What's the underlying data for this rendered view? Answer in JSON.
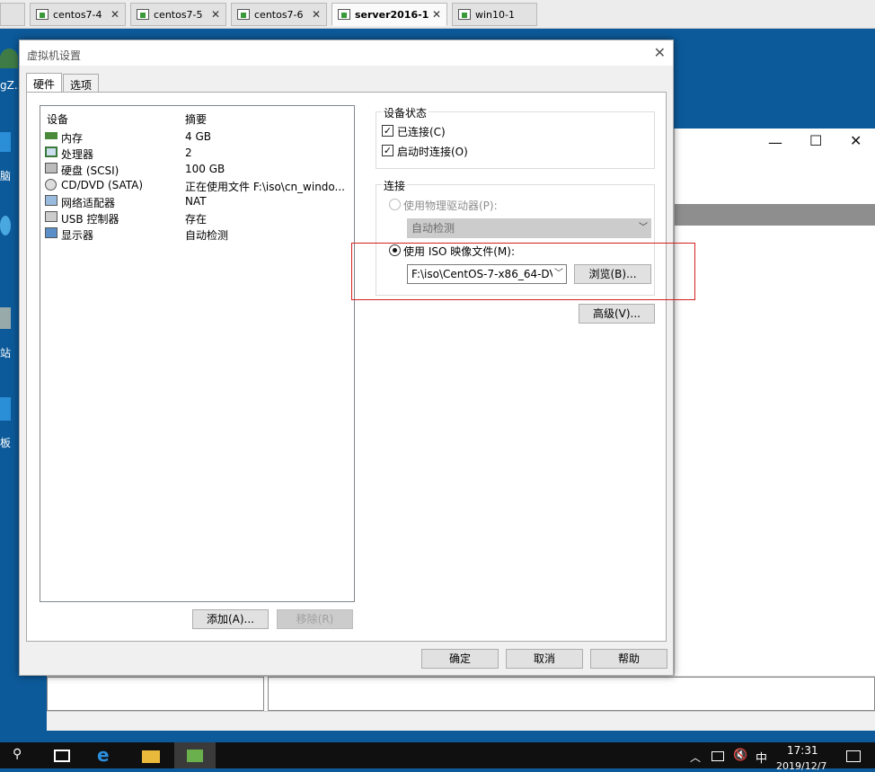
{
  "tabs": [
    {
      "label": "centos7-4",
      "active": false
    },
    {
      "label": "centos7-5",
      "active": false
    },
    {
      "label": "centos7-6",
      "active": false
    },
    {
      "label": "server2016-1",
      "active": true
    },
    {
      "label": "win10-1",
      "active": false
    }
  ],
  "desktop_icons": [
    "gZ...",
    "脑",
    "站",
    "板"
  ],
  "dialog": {
    "title": "虚拟机设置",
    "tabs": [
      "硬件",
      "选项"
    ],
    "list_headers": {
      "device": "设备",
      "summary": "摘要"
    },
    "devices": [
      {
        "name": "内存",
        "summary": "4 GB",
        "icon": "memory-icon"
      },
      {
        "name": "处理器",
        "summary": "2",
        "icon": "cpu-icon"
      },
      {
        "name": "硬盘 (SCSI)",
        "summary": "100 GB",
        "icon": "harddisk-icon"
      },
      {
        "name": "CD/DVD (SATA)",
        "summary": "正在使用文件 F:\\iso\\cn_windo...",
        "icon": "cd-icon"
      },
      {
        "name": "网络适配器",
        "summary": "NAT",
        "icon": "network-icon"
      },
      {
        "name": "USB 控制器",
        "summary": "存在",
        "icon": "usb-icon"
      },
      {
        "name": "显示器",
        "summary": "自动检测",
        "icon": "monitor-icon"
      }
    ],
    "add_button": "添加(A)...",
    "remove_button": "移除(R)",
    "device_status": {
      "legend": "设备状态",
      "connected": "已连接(C)",
      "connect_on_power": "启动时连接(O)"
    },
    "connection": {
      "legend": "连接",
      "physical_drive": "使用物理驱动器(P):",
      "auto_detect": "自动检测",
      "use_iso": "使用 ISO 映像文件(M):",
      "iso_path": "F:\\iso\\CentOS-7-x86_64-DV",
      "browse": "浏览(B)..."
    },
    "advanced": "高级(V)...",
    "ok": "确定",
    "cancel": "取消",
    "help": "帮助"
  },
  "taskbar": {
    "time": "17:31",
    "date": "2019/12/7",
    "ime": "中"
  },
  "colors": {
    "highlight_box": "#d42020",
    "desktop": "#0c5a9a",
    "taskbar": "#101010"
  }
}
